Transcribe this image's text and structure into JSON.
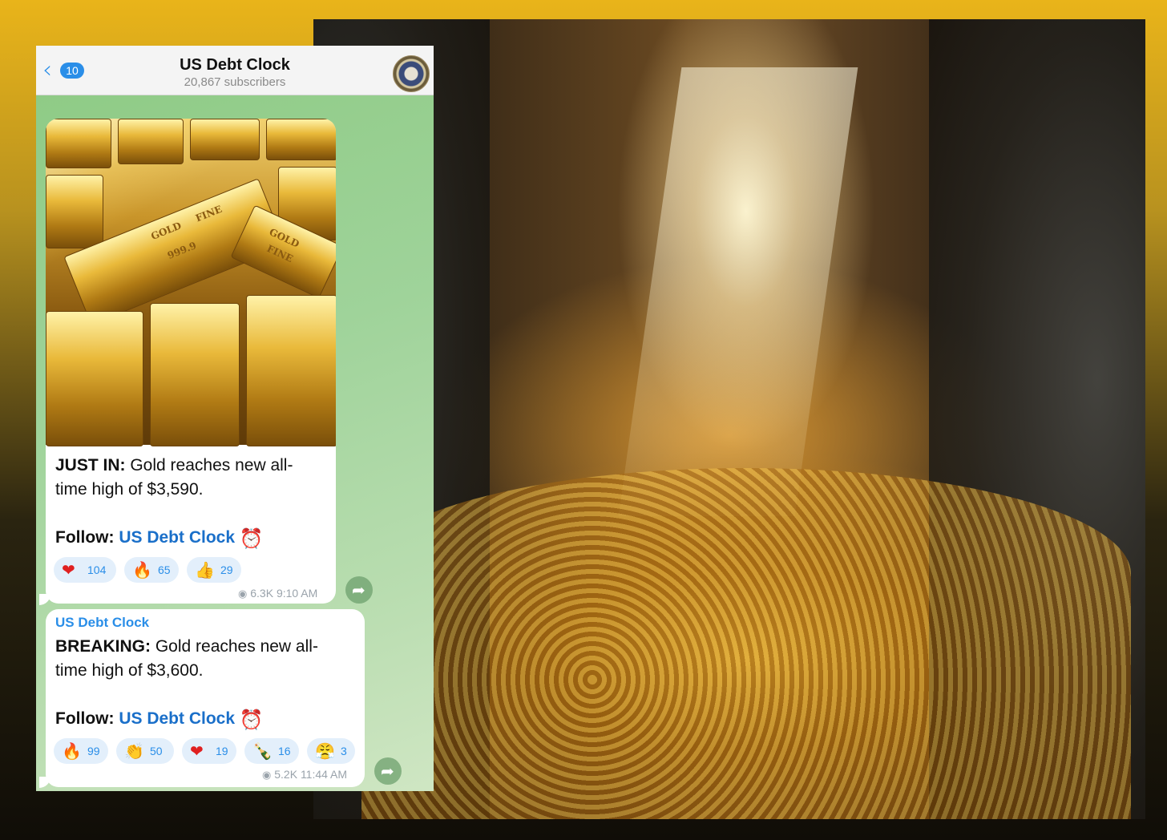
{
  "header": {
    "back_count": "10",
    "title": "US Debt Clock",
    "subtitle": "20,867 subscribers"
  },
  "icons": {
    "back": "chevron-left-icon",
    "avatar": "channel-avatar",
    "alarm": "alarm-clock-icon",
    "views": "eye-icon",
    "share": "share-icon"
  },
  "messages": [
    {
      "lead": "JUST IN:",
      "line1": " Gold reaches new all-",
      "line2": "time high of $3,590.",
      "follow_label": "Follow: ",
      "follow_link": "US Debt Clock",
      "reactions": [
        {
          "emoji": "❤",
          "count": "104",
          "color": "#e02020"
        },
        {
          "emoji": "🔥",
          "count": "65",
          "color": "#ff6a00"
        },
        {
          "emoji": "👍",
          "count": "29",
          "color": "#f5b800"
        }
      ],
      "views": "6.3K",
      "time": "9:10 AM",
      "photo_bar_labels": [
        "GOLD",
        "FINE",
        "999.9",
        "GOLD",
        "FINE"
      ]
    },
    {
      "author": "US Debt Clock",
      "lead": "BREAKING:",
      "line1": " Gold reaches new all-",
      "line2": "time high of $3,600.",
      "follow_label": "Follow: ",
      "follow_link": "US Debt Clock",
      "reactions": [
        {
          "emoji": "🔥",
          "count": "99",
          "color": "#ff6a00"
        },
        {
          "emoji": "👏",
          "count": "50",
          "color": "#f5b800"
        },
        {
          "emoji": "❤",
          "count": "19",
          "color": "#e02020"
        },
        {
          "emoji": "🍾",
          "count": "16",
          "color": "#3a8a3a"
        },
        {
          "emoji": "😤",
          "count": "3",
          "color": "#f5b800"
        }
      ],
      "views": "5.2K",
      "time": "11:44 AM"
    }
  ],
  "colors": {
    "accent": "#2a8ee8",
    "link": "#1a6fc9",
    "chat_background": "#9dcf8f",
    "frame_top": "#e9b41a"
  }
}
